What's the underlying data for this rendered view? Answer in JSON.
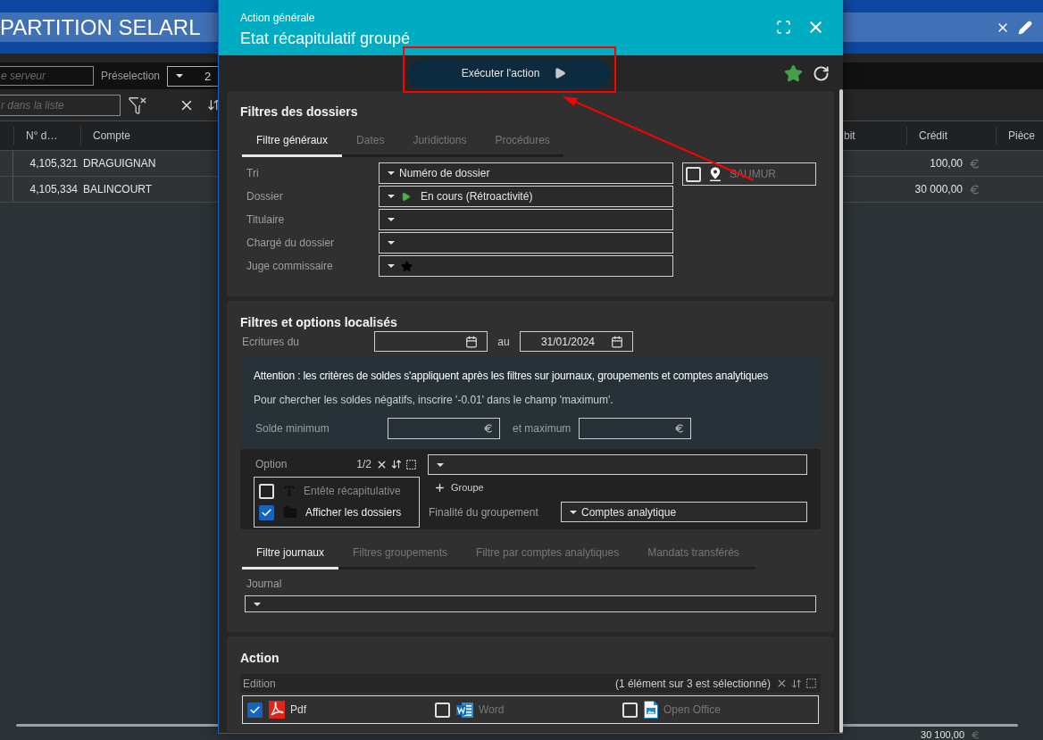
{
  "app_header": {
    "title": "PARTITION SELARL"
  },
  "toolbar": {
    "server_search": {
      "placeholder": "e serveur"
    },
    "preselection": {
      "label": "Préselection",
      "value": "2"
    },
    "list_search": {
      "placeholder": "r dans la liste"
    }
  },
  "table": {
    "columns": [
      "N° d…",
      "Compte",
      "bit",
      "Crédit",
      "Pièce"
    ],
    "rows": [
      {
        "number": "4,105,321",
        "account": "DRAGUIGNAN",
        "credit": "100,00"
      },
      {
        "number": "4,105,334",
        "account": "BALINCOURT",
        "credit": "30 000,00"
      }
    ],
    "total_credit": "30 100,00"
  },
  "dialog": {
    "subtitle": "Action générale",
    "title": "Etat récapitulatif groupé",
    "execute_button": "Exécuter l'action",
    "favorite": true,
    "folder_filters": {
      "title": "Filtres des dossiers",
      "tabs": [
        {
          "label": "Filtre généraux",
          "selected": true
        },
        {
          "label": "Dates",
          "selected": false
        },
        {
          "label": "Juridictions",
          "selected": false
        },
        {
          "label": "Procédures",
          "selected": false
        }
      ],
      "fields": [
        {
          "label": "Tri",
          "value": "Numéro de dossier",
          "kind": "plain"
        },
        {
          "label": "Dossier",
          "value": "En cours (Rétroactivité)",
          "kind": "status"
        },
        {
          "label": "Titulaire",
          "kind": "plain"
        },
        {
          "label": "Chargé du dossier",
          "kind": "plain"
        },
        {
          "label": "Juge commissaire",
          "kind": "starred"
        }
      ],
      "location": {
        "checked": false,
        "placeholder": "SAUMUR"
      }
    },
    "local_filters": {
      "title": "Filtres et options localisés",
      "date_label": "Ecritures du",
      "date_separator": "au",
      "date_to": "31/01/2024",
      "notice": {
        "warning": "Attention : les critères de soldes s'appliquent après les filtres sur journaux, groupements et comptes analytiques",
        "hint": "Pour chercher les soldes négatifs, inscrire '-0.01' dans le champ 'maximum'.",
        "min_label": "Solde minimum",
        "max_label": "et maximum"
      },
      "options": {
        "label": "Option",
        "count": "1/2",
        "items": [
          {
            "label": "Entête récapitulative",
            "checked": false,
            "kind": "text"
          },
          {
            "label": "Afficher les dossiers",
            "checked": true,
            "kind": "folder"
          }
        ],
        "add_group": "Groupe",
        "purpose_label": "Finalité du groupement",
        "purpose_value": "Comptes analytique"
      },
      "tabs": [
        {
          "label": "Filtre journaux",
          "selected": true
        },
        {
          "label": "Filtres groupements",
          "selected": false
        },
        {
          "label": "Filtre par comptes analytiques",
          "selected": false
        },
        {
          "label": "Mandats transférés",
          "selected": false
        }
      ],
      "journal_label": "Journal"
    },
    "action": {
      "title": "Action",
      "list_label": "Edition",
      "selection_count": "(1 élément sur 3 est sélectionné)",
      "formats": [
        {
          "label": "Pdf",
          "checked": true,
          "kind": "pdf"
        },
        {
          "label": "Word",
          "checked": false,
          "kind": "word"
        },
        {
          "label": "Open Office",
          "checked": false,
          "kind": "writer"
        }
      ]
    }
  }
}
